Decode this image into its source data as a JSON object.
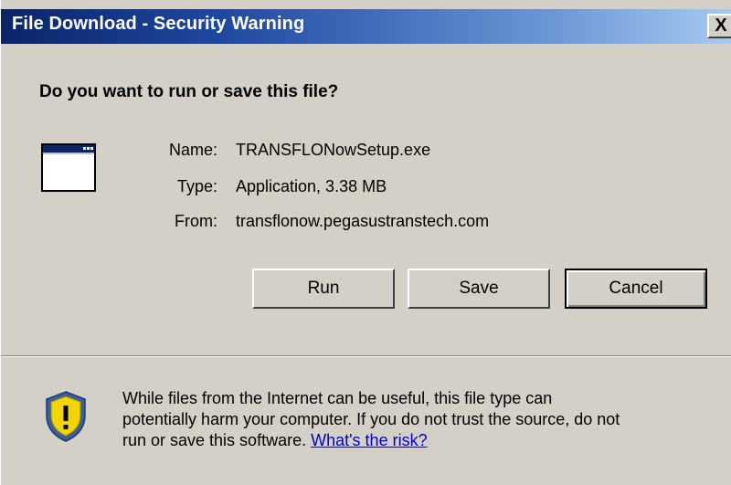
{
  "window": {
    "title": "File Download - Security Warning",
    "close_label": "X"
  },
  "question": "Do you want to run or save this file?",
  "file": {
    "name_label": "Name:",
    "name_value": "TRANSFLONowSetup.exe",
    "type_label": "Type:",
    "type_value": "Application, 3.38 MB",
    "from_label": "From:",
    "from_value": "transflonow.pegasustranstech.com",
    "icon": "application-window-icon"
  },
  "buttons": {
    "run_label": "Run",
    "save_label": "Save",
    "cancel_label": "Cancel"
  },
  "warning": {
    "icon": "shield-warning-icon",
    "line1": "While files from the Internet can be useful, this file type can",
    "line2": "potentially harm your computer. If you do not trust the source, do not",
    "line3_prefix": "run or save this software.",
    "risk_link": "What's the risk?"
  },
  "colors": {
    "title_gradient_start": "#0a246a",
    "title_gradient_end": "#a6caf0",
    "dialog_background": "#d4d0c8",
    "link": "#0000cc",
    "shield_yellow": "#f2d400"
  }
}
